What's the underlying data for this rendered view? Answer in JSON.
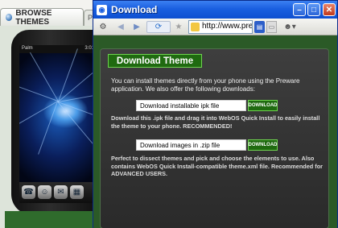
{
  "background": {
    "tab_label": "BROWSE THEMES",
    "tab2_label": "P",
    "phone": {
      "status_left": "Palm",
      "status_right": "3:01"
    }
  },
  "window": {
    "title": "Download",
    "controls": {
      "minimize": "–",
      "maximize": "□",
      "close": "✕"
    }
  },
  "toolbar": {
    "url": "http://www.preth"
  },
  "content": {
    "heading": "Download Theme",
    "intro": "You can install themes directly from your phone using the Preware application. We also offer the following downloads:",
    "ipk": {
      "field": "Download installable ipk file",
      "button": "DOWNLOAD",
      "description": "Download this .ipk file and drag it into WebOS Quick Install to easily install the theme to your phone. RECOMMENDED!"
    },
    "zip": {
      "field": "Download images in .zip file",
      "button": "DOWNLOAD",
      "description": "Perfect to dissect themes and pick and choose the elements to use. Also contains WebOS Quick Install-compatible theme.xml file. Recommended for ADVANCED USERS."
    }
  },
  "colors": {
    "titlebar": "#1a5fe0",
    "page_green": "#2b5a27",
    "panel": "#333333",
    "accent_green": "#1f6a10"
  },
  "icons": [
    "browser-tab-icon",
    "phone-dock-icons",
    "window-app-icon",
    "gear-icon",
    "back-arrow-icon",
    "forward-arrow-icon",
    "reload-icon",
    "bookmark-icon",
    "favicon-icon",
    "page-icon",
    "settings-icon",
    "user-icon"
  ]
}
